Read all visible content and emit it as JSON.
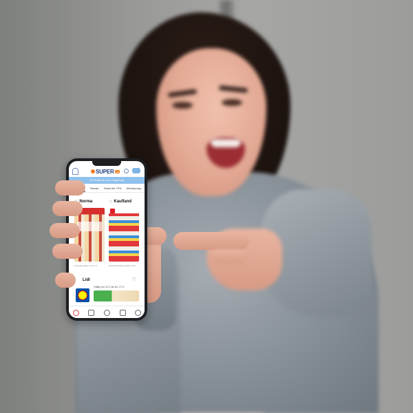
{
  "scene": {
    "description_icon": "photo-background"
  },
  "phone_app": {
    "brand": {
      "name": "SUPER",
      "tld": ".de",
      "logo_color": "#f07a1a",
      "brand_color": "#1f3a7a"
    },
    "location_text": "10115 Berlin und Umgebung",
    "tabs": [
      {
        "label": "Entdecken",
        "active": true
      },
      {
        "label": "Neuste"
      },
      {
        "label": "Deals bis 70%"
      },
      {
        "label": "Werbeprosp."
      }
    ],
    "offers": [
      {
        "store": "Norma",
        "caption": "Prospekt gültig: noch 5 T..."
      },
      {
        "store": "Kaufland",
        "caption": "Wochenangebote gültig: bis 2..."
      }
    ],
    "featured": {
      "store": "Lidl",
      "validity": "Gültig von 22.2. bis So. 27.2."
    },
    "accent_colors": {
      "location_bar": "#8fc1ec",
      "kaufland": "#e31b23",
      "lidl_blue": "#0050aa",
      "lidl_yellow": "#fff200"
    }
  }
}
